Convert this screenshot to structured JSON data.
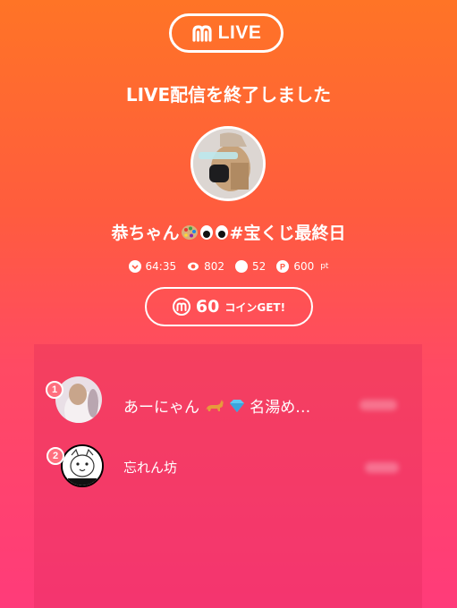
{
  "brand": {
    "label": "LIVE",
    "icon": "m-logo-icon"
  },
  "headline": "LIVE配信を終了しました",
  "streamer": {
    "avatar_icon": "streamer-avatar",
    "name_prefix": "恭ちゃん",
    "name_suffix": "#宝くじ最終日"
  },
  "stats": {
    "duration": "64:35",
    "views": "802",
    "comments": "52",
    "points": "600",
    "points_unit": "pt"
  },
  "coin_button": {
    "amount": "60",
    "suffix": "コインGET!"
  },
  "ranking": [
    {
      "rank": "1",
      "name_prefix": "あーにゃん",
      "name_suffix": "名湯め…"
    },
    {
      "rank": "2",
      "name": "忘れん坊"
    }
  ],
  "colors": {
    "gradient_top": "#ff7426",
    "gradient_bottom": "#ff3b7a",
    "badge": "#ff6f7e"
  }
}
